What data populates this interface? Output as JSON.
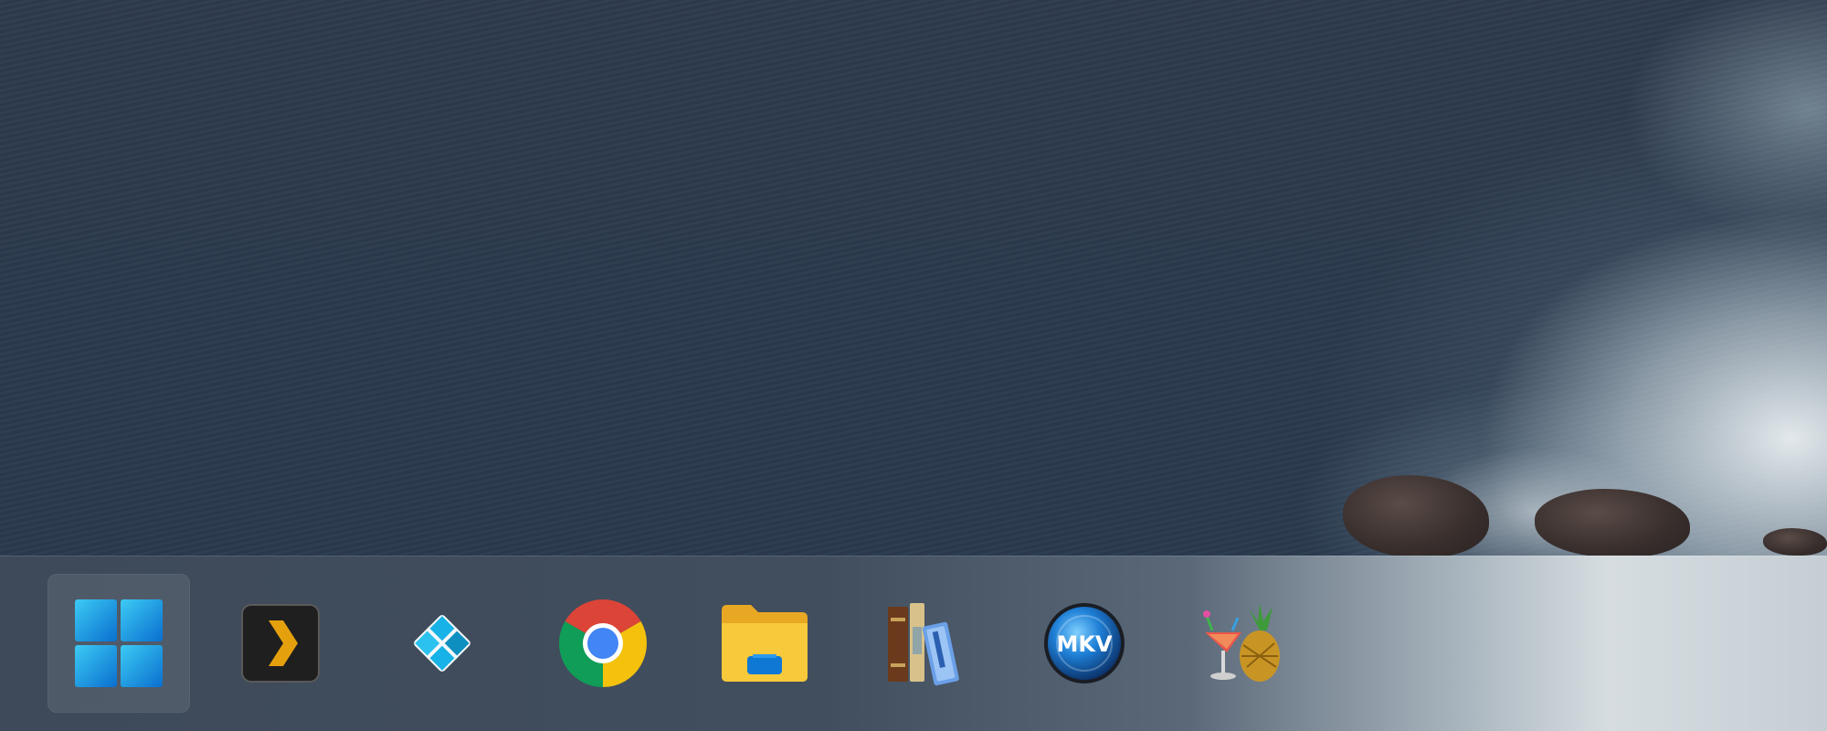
{
  "desktop": {
    "wallpaper": "ocean-coast"
  },
  "taskbar": {
    "items": [
      {
        "id": "start",
        "icon": "windows-logo-icon",
        "active": true
      },
      {
        "id": "plex",
        "icon": "plex-icon",
        "active": false
      },
      {
        "id": "kodi",
        "icon": "kodi-icon",
        "active": false
      },
      {
        "id": "chrome",
        "icon": "chrome-icon",
        "active": false
      },
      {
        "id": "file-explorer",
        "icon": "folder-icon",
        "active": false
      },
      {
        "id": "calibre",
        "icon": "books-icon",
        "active": false
      },
      {
        "id": "mkvtoolnix",
        "icon": "mkv-icon",
        "active": false,
        "label": "MKV"
      },
      {
        "id": "handbrake",
        "icon": "handbrake-icon",
        "active": false
      }
    ]
  },
  "colors": {
    "windows_blue": "#0f8ad8",
    "plex_orange": "#e5a00d",
    "kodi_blue": "#17b2e7",
    "chrome_red": "#db4437",
    "chrome_yellow": "#f4c20d",
    "chrome_green": "#0f9d58",
    "chrome_blue": "#4285f4",
    "folder_yellow": "#f8c93a"
  }
}
